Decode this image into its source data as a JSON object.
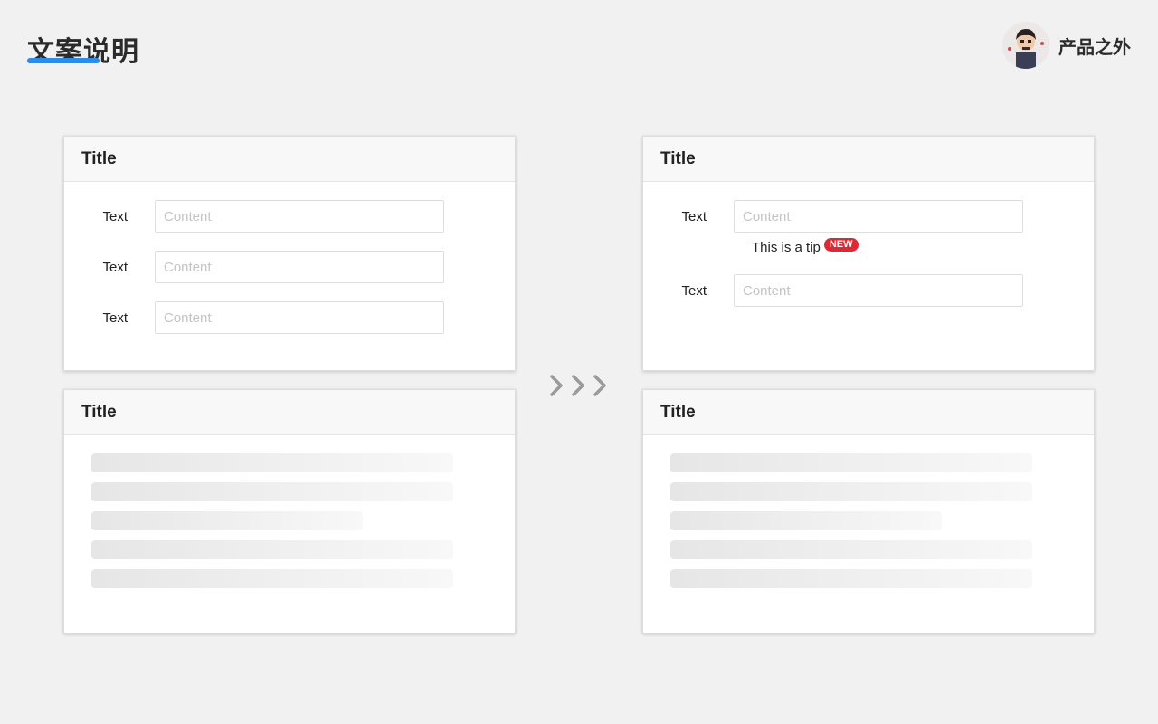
{
  "header": {
    "title": "文案说明",
    "accent_color": "#1e90ff",
    "brand_name": "产品之外",
    "avatar_icon": "avatar-icon"
  },
  "transition_icon": "triple-chevron-right-icon",
  "before": {
    "form_card": {
      "title": "Title",
      "rows": [
        {
          "label": "Text",
          "placeholder": "Content"
        },
        {
          "label": "Text",
          "placeholder": "Content"
        },
        {
          "label": "Text",
          "placeholder": "Content"
        }
      ]
    },
    "skeleton_card": {
      "title": "Title"
    }
  },
  "after": {
    "form_card": {
      "title": "Title",
      "rows": [
        {
          "label": "Text",
          "placeholder": "Content"
        },
        {
          "label": "Text",
          "placeholder": "Content"
        }
      ],
      "tip": "This is a tip",
      "tip_badge": "NEW",
      "badge_color": "#e8242f"
    },
    "skeleton_card": {
      "title": "Title"
    }
  }
}
